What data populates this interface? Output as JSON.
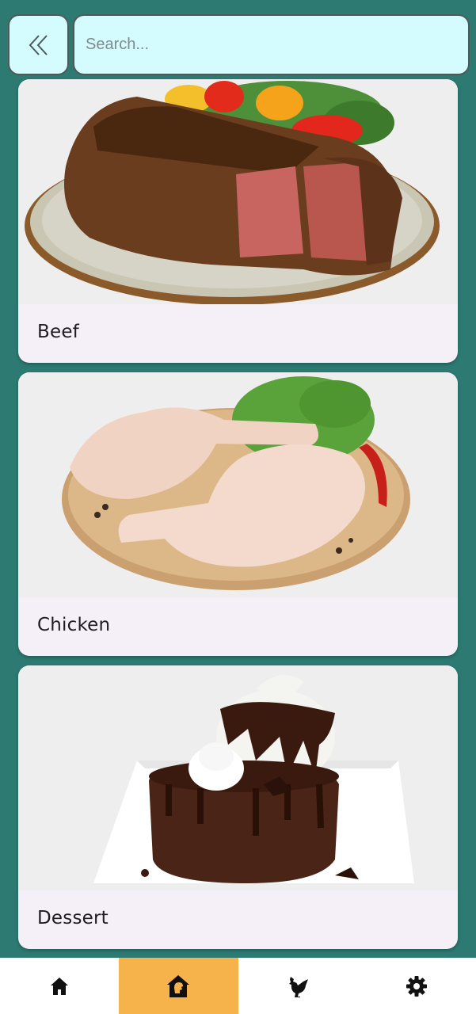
{
  "search": {
    "placeholder": "Search..."
  },
  "categories": [
    {
      "label": "Beef",
      "image": "beef-steak-plate"
    },
    {
      "label": "Chicken",
      "image": "raw-chicken-legs-board"
    },
    {
      "label": "Dessert",
      "image": "chocolate-lava-cake"
    }
  ],
  "nav": {
    "items": [
      {
        "icon": "home-icon"
      },
      {
        "icon": "category-home-icon",
        "active": true
      },
      {
        "icon": "chicken-icon"
      },
      {
        "icon": "settings-gear-icon"
      }
    ],
    "active_color": "#f7b34b"
  },
  "colors": {
    "background": "#2d7a72",
    "search_bg": "#d4fbfd",
    "card_bg": "#f5f0f8"
  }
}
